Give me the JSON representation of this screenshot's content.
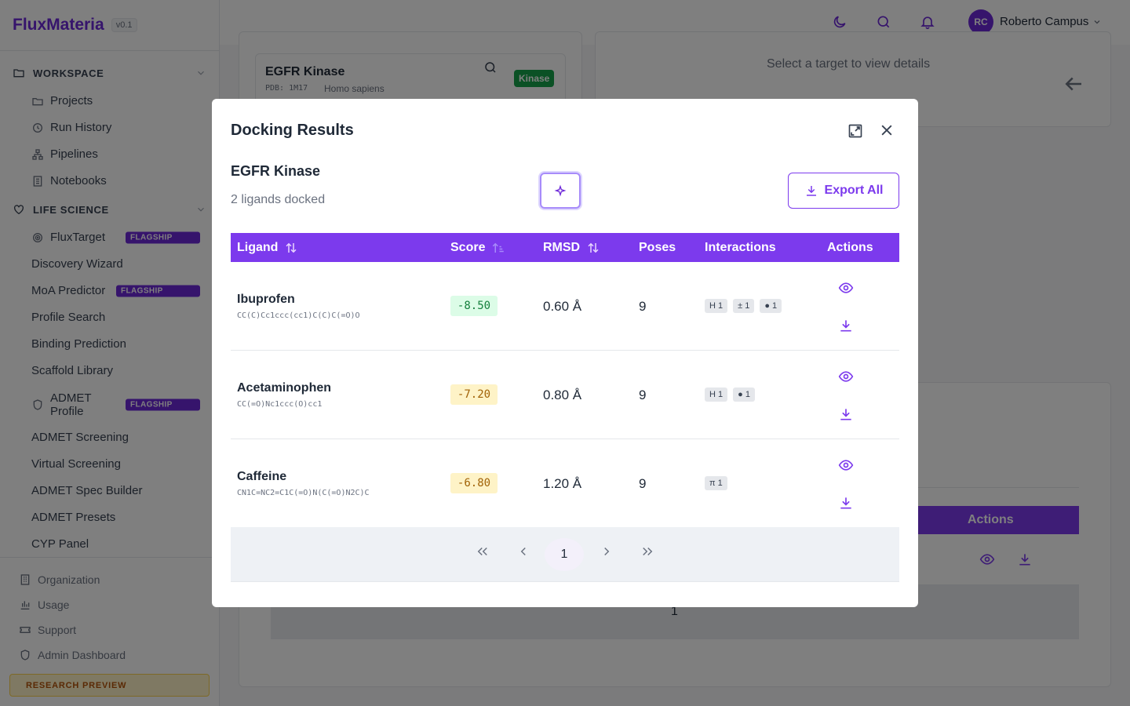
{
  "brand": {
    "name": "FluxMateria",
    "version": "v0.1"
  },
  "sections": {
    "workspace": "WORKSPACE",
    "life_science": "LIFE SCIENCE"
  },
  "workspace_items": [
    "Projects",
    "Run History",
    "Pipelines",
    "Notebooks"
  ],
  "life_items": {
    "fluxtarget": "FluxTarget",
    "discovery": "Discovery Wizard",
    "moa": "MoA Predictor",
    "profile_search": "Profile Search",
    "binding": "Binding Prediction",
    "scaffold": "Scaffold Library",
    "admet_profile": "ADMET Profile",
    "admet_screening": "ADMET Screening",
    "virtual": "Virtual Screening",
    "spec_builder": "ADMET Spec Builder",
    "presets": "ADMET Presets",
    "cyp": "CYP Panel"
  },
  "flag_label": "FLAGSHIP",
  "footer": [
    "Organization",
    "Usage",
    "Support",
    "Admin Dashboard"
  ],
  "preview_badge": "RESEARCH PREVIEW",
  "user": {
    "initials": "RC",
    "name": "Roberto Campus"
  },
  "background": {
    "target_name": "EGFR Kinase",
    "pdb": "PDB: 1M17",
    "organism": "Homo sapiens",
    "tag": "Kinase",
    "detail_hint": "Select a target to view details",
    "actions_header": "Actions",
    "page": "1"
  },
  "modal": {
    "title": "Docking Results",
    "target": "EGFR Kinase",
    "subtitle": "2 ligands docked",
    "export_label": "Export All",
    "columns": {
      "ligand": "Ligand",
      "score": "Score",
      "rmsd": "RMSD",
      "poses": "Poses",
      "interactions": "Interactions",
      "actions": "Actions"
    },
    "rows": [
      {
        "name": "Ibuprofen",
        "smiles": "CC(C)Cc1ccc(cc1)C(C)C(=O)O",
        "score": "-8.50",
        "rmsd": "0.60 Å",
        "poses": "9",
        "chips": [
          "H 1",
          "± 1",
          "● 1"
        ]
      },
      {
        "name": "Acetaminophen",
        "smiles": "CC(=O)Nc1ccc(O)cc1",
        "score": "-7.20",
        "rmsd": "0.80 Å",
        "poses": "9",
        "chips": [
          "H 1",
          "● 1"
        ]
      },
      {
        "name": "Caffeine",
        "smiles": "CN1C=NC2=C1C(=O)N(C(=O)N2C)C",
        "score": "-6.80",
        "rmsd": "1.20 Å",
        "poses": "9",
        "chips": [
          "π 1"
        ]
      }
    ],
    "score_colors": {
      "good": "#dcfce7",
      "good_text": "#15803d",
      "mid": "#fef3c7",
      "mid_text": "#a16207"
    },
    "page": "1"
  },
  "colors": {
    "accent": "#7c3aed",
    "brand": "#6d28d9",
    "tag_green": "#16a34a"
  }
}
